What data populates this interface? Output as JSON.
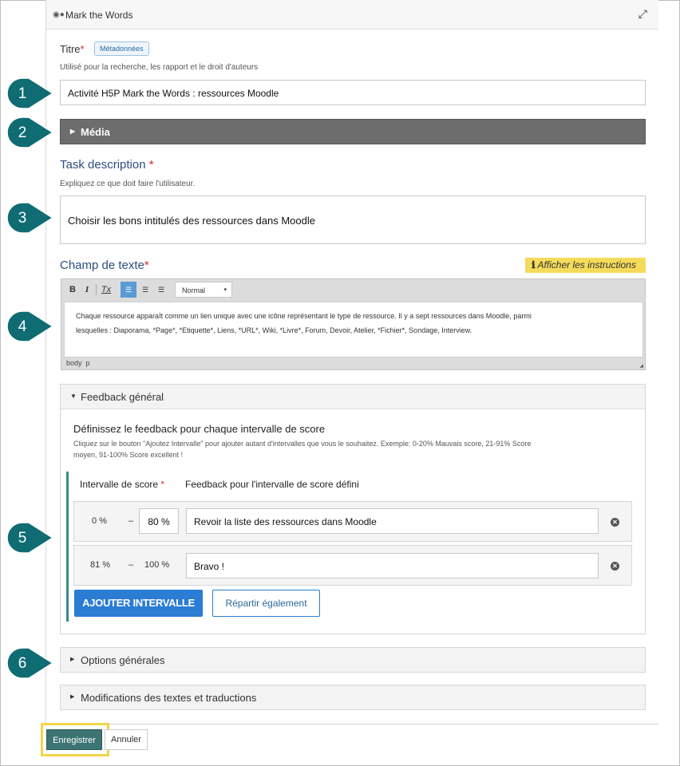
{
  "window": {
    "title": "Mark the Words"
  },
  "titre": {
    "label": "Titre",
    "required": "*",
    "metadata_button": "Métadonnées",
    "description": "Utilisé pour la recherche, les rapport et le droit d'auteurs",
    "value": "Activité H5P Mark the Words : ressources Moodle"
  },
  "media": {
    "label": "Média"
  },
  "task": {
    "label": "Task description",
    "required": "*",
    "description": "Expliquez ce que doit faire l'utilisateur.",
    "value": "Choisir les bons intitulés des ressources dans Moodle"
  },
  "champ": {
    "label": "Champ de texte",
    "required": "*",
    "instructions_button": "Afficher les instructions",
    "toolbar": {
      "bold": "B",
      "italic": "I",
      "clear": "Tx",
      "format": "Normal"
    },
    "line1": "Chaque ressource apparaît comme un lien unique avec une icône représentant le type de ressource. Il y a sept ressources dans Moodle, parmi",
    "line2": "lesquelles : Diaporama, *Page*,  *Etiquette*,  Liens, *URL*, Wiki, *Livre*, Forum, Devoir, Atelier, *Fichier*, Sondage, Interview.",
    "status_body": "body",
    "status_p": "p"
  },
  "feedback": {
    "header": "Feedback général",
    "title": "Définissez le feedback pour chaque intervalle de score",
    "help": "Cliquez sur le bouton \"Ajoutez Intervalle\" pour ajouter autant d'intervalles que vous le souhaitez. Exemple: 0-20% Mauvais score, 21-91% Score",
    "help2": "moyen, 91-100% Score excellent !",
    "col_range": "Intervalle de score",
    "col_feedback": "Feedback pour l'intervalle de score défini",
    "required": "*",
    "rows": [
      {
        "from": "0 %",
        "dash": "–",
        "to": "80 %",
        "text": "Revoir la liste des ressources dans Moodle"
      },
      {
        "from": "81 %",
        "dash": "–",
        "to": "100 %",
        "text": "Bravo !"
      }
    ],
    "add_button": "AJOUTER INTERVALLE",
    "distribute_button": "Répartir également"
  },
  "options": {
    "header": "Options générales"
  },
  "translations": {
    "header": "Modifications des textes et traductions"
  },
  "footer": {
    "save": "Enregistrer",
    "cancel": "Annuler"
  },
  "callouts": [
    "1",
    "2",
    "3",
    "4",
    "5",
    "6"
  ],
  "colors": {
    "callout": "#0f6c73",
    "media_bar": "#6d6d6d",
    "primary_button": "#2b7cd3",
    "instructions": "#f5db5a",
    "save_button": "#3c7373",
    "highlight": "#f3d44b"
  }
}
